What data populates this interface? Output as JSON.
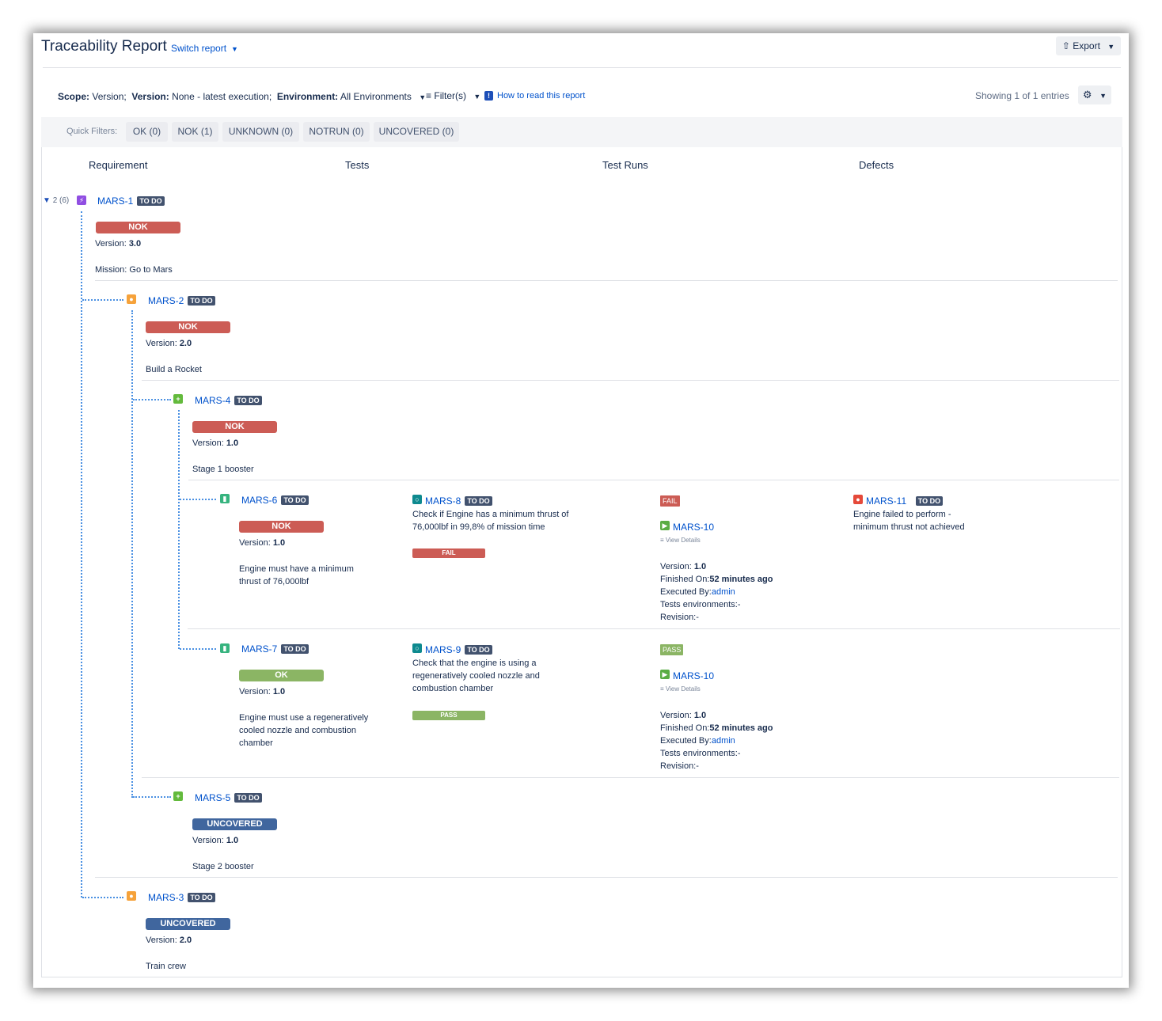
{
  "header": {
    "title": "Traceability Report",
    "switch_report": "Switch report",
    "export_label": "Export"
  },
  "scope_bar": {
    "scope_label": "Scope:",
    "scope_value": "Version;",
    "version_label": "Version:",
    "version_value": "None - latest execution;",
    "environment_label": "Environment:",
    "environment_value": "All Environments",
    "filters_label": "Filter(s)",
    "howto_label": "How to read this report",
    "showing": "Showing 1 of 1 entries"
  },
  "quick_filters": {
    "label": "Quick Filters:",
    "items": [
      "OK (0)",
      "NOK (1)",
      "UNKNOWN (0)",
      "NOTRUN (0)",
      "UNCOVERED (0)"
    ]
  },
  "columns": [
    "Requirement",
    "Tests",
    "Test Runs",
    "Defects"
  ],
  "tree_count": "2 (6)",
  "todo": "TO DO",
  "version_label": "Version:",
  "requirements": {
    "mars1": {
      "key": "MARS-1",
      "status": "NOK",
      "version": "3.0",
      "summary": "Mission: Go to Mars"
    },
    "mars2": {
      "key": "MARS-2",
      "status": "NOK",
      "version": "2.0",
      "summary": "Build a Rocket"
    },
    "mars4": {
      "key": "MARS-4",
      "status": "NOK",
      "version": "1.0",
      "summary": "Stage 1 booster"
    },
    "mars6": {
      "key": "MARS-6",
      "status": "NOK",
      "version": "1.0",
      "summary1": "Engine must have a minimum",
      "summary2": "thrust of 76,000lbf"
    },
    "mars7": {
      "key": "MARS-7",
      "status": "OK",
      "version": "1.0",
      "summary1": "Engine must use a regeneratively",
      "summary2": "cooled nozzle and combustion",
      "summary3": "chamber"
    },
    "mars5": {
      "key": "MARS-5",
      "status": "UNCOVERED",
      "version": "1.0",
      "summary": "Stage 2 booster"
    },
    "mars3": {
      "key": "MARS-3",
      "status": "UNCOVERED",
      "version": "2.0",
      "summary": "Train crew"
    }
  },
  "tests": {
    "mars8": {
      "key": "MARS-8",
      "line1": "Check if Engine has a minimum thrust of",
      "line2": "76,000lbf in 99,8% of mission time",
      "status": "FAIL"
    },
    "mars9": {
      "key": "MARS-9",
      "line1": "Check that the engine is using a",
      "line2": "regeneratively cooled nozzle and",
      "line3": "combustion chamber",
      "status": "PASS"
    }
  },
  "runs": {
    "run1": {
      "chip": "FAIL",
      "exec_key": "MARS-10",
      "view_details": "View Details",
      "version": "1.0",
      "finished_label": "Finished On:",
      "finished": "52 minutes ago",
      "executed_label": "Executed By:",
      "executed_by": "admin",
      "envs": "Tests environments:-",
      "revision": "Revision:-"
    },
    "run2": {
      "chip": "PASS",
      "exec_key": "MARS-10",
      "view_details": "View Details",
      "version": "1.0",
      "finished_label": "Finished On:",
      "finished": "52 minutes ago",
      "executed_label": "Executed By:",
      "executed_by": "admin",
      "envs": "Tests environments:-",
      "revision": "Revision:-"
    }
  },
  "defects": {
    "mars11": {
      "key": "MARS-11",
      "line1": "Engine failed to perform -",
      "line2": "minimum thrust not achieved"
    }
  },
  "colors": {
    "nok": "#cc5c55",
    "ok": "#8bb564",
    "uncovered": "#40669e",
    "link": "#0052cc",
    "dotted": "#4a90e2"
  }
}
